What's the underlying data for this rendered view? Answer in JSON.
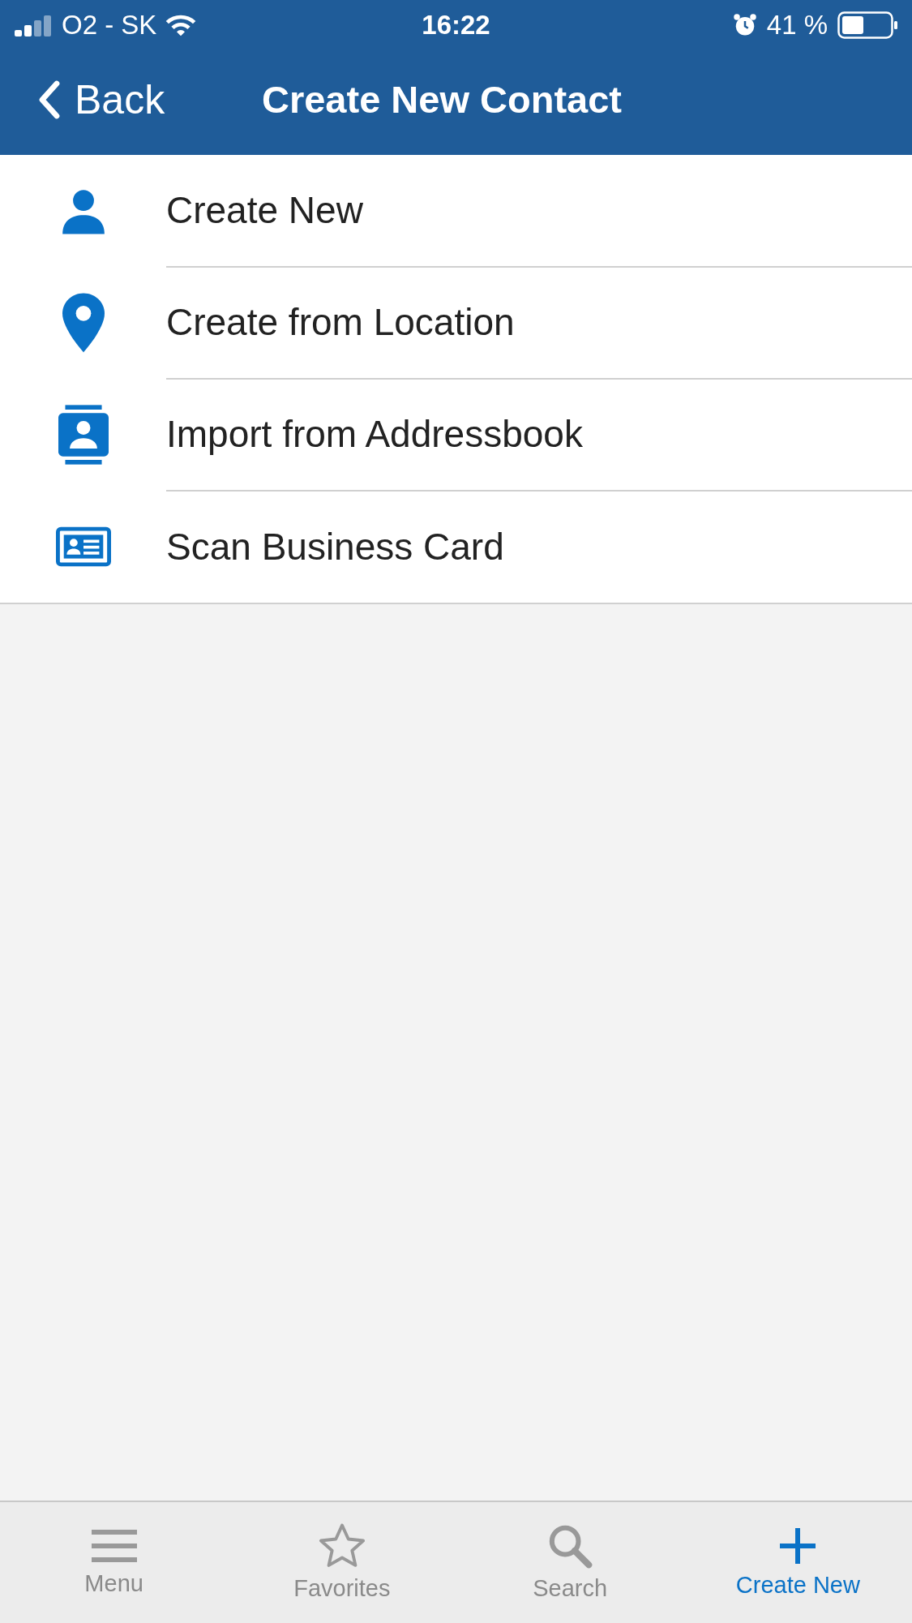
{
  "status_bar": {
    "carrier": "O2 - SK",
    "time": "16:22",
    "battery": "41 %"
  },
  "nav_bar": {
    "back": "Back",
    "title": "Create New Contact"
  },
  "items": [
    {
      "label": "Create New"
    },
    {
      "label": "Create from Location"
    },
    {
      "label": "Import from Addressbook"
    },
    {
      "label": "Scan Business Card"
    }
  ],
  "tabs": [
    {
      "label": "Menu",
      "selected": false
    },
    {
      "label": "Favorites",
      "selected": false
    },
    {
      "label": "Search",
      "selected": false
    },
    {
      "label": "Create New",
      "selected": true
    }
  ]
}
